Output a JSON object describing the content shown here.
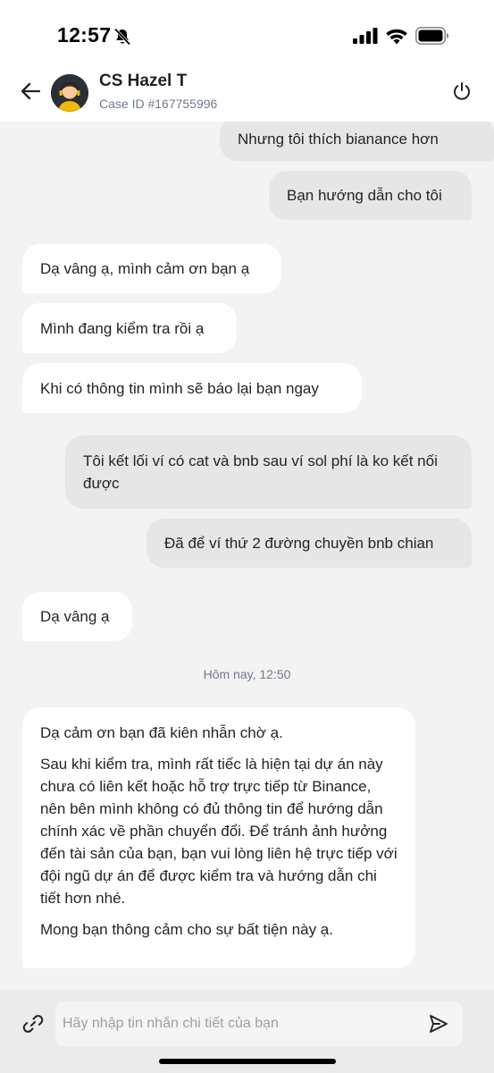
{
  "status_bar": {
    "time": "12:57",
    "icons": [
      "bell-slash-icon",
      "cellular-signal-icon",
      "wifi-icon",
      "battery-icon"
    ]
  },
  "header": {
    "agent_name": "CS Hazel T",
    "case_id": "Case ID #167755996",
    "icons": [
      "back-arrow-icon",
      "agent-avatar",
      "power-icon"
    ]
  },
  "messages": [
    {
      "side": "out",
      "text": "Nhưng tôi thích bianance hơn"
    },
    {
      "side": "out",
      "text": "Bạn hướng dẫn cho tôi"
    },
    {
      "side": "in",
      "text": "Dạ vâng ạ, mình cảm ơn bạn ạ"
    },
    {
      "side": "in",
      "text": "Mình đang kiểm tra rồi ạ"
    },
    {
      "side": "in",
      "text": "Khi có thông tin mình sẽ báo lại bạn ngay"
    },
    {
      "side": "out",
      "text": "Tôi kết lối ví có cat và bnb sau ví sol phí là ko kết nối được"
    },
    {
      "side": "out",
      "text": "Đã để ví thứ 2 đường chuyền bnb chian"
    },
    {
      "side": "in",
      "text": "Dạ vâng ạ"
    }
  ],
  "timestamp": "Hôm nay, 12:50",
  "long_message": {
    "side": "in",
    "paragraphs": [
      "Dạ cảm ơn bạn đã kiên nhẫn chờ ạ.",
      "Sau khi kiểm tra, mình rất tiếc là hiện tại dự án này chưa có liên kết hoặc hỗ trợ trực tiếp từ Binance, nên bên mình không có đủ thông tin để hướng dẫn chính xác về phần chuyển đổi. Để tránh ảnh hưởng đến tài sản của bạn, bạn vui lòng liên hệ trực tiếp với đội ngũ dự án để được kiểm tra và hướng dẫn chi tiết hơn nhé.",
      "Mong bạn thông cảm cho sự bất tiện này ạ."
    ]
  },
  "composer": {
    "placeholder": "Hãy nhập tin nhắn chi tiết của bạn",
    "value": "",
    "icons": [
      "link-icon",
      "send-icon"
    ]
  },
  "colors": {
    "background": "#f3f3f3",
    "incoming_bubble": "#ffffff",
    "outgoing_bubble": "#e6e6e6",
    "text": "#1e2329",
    "muted_text": "#707a8a"
  }
}
